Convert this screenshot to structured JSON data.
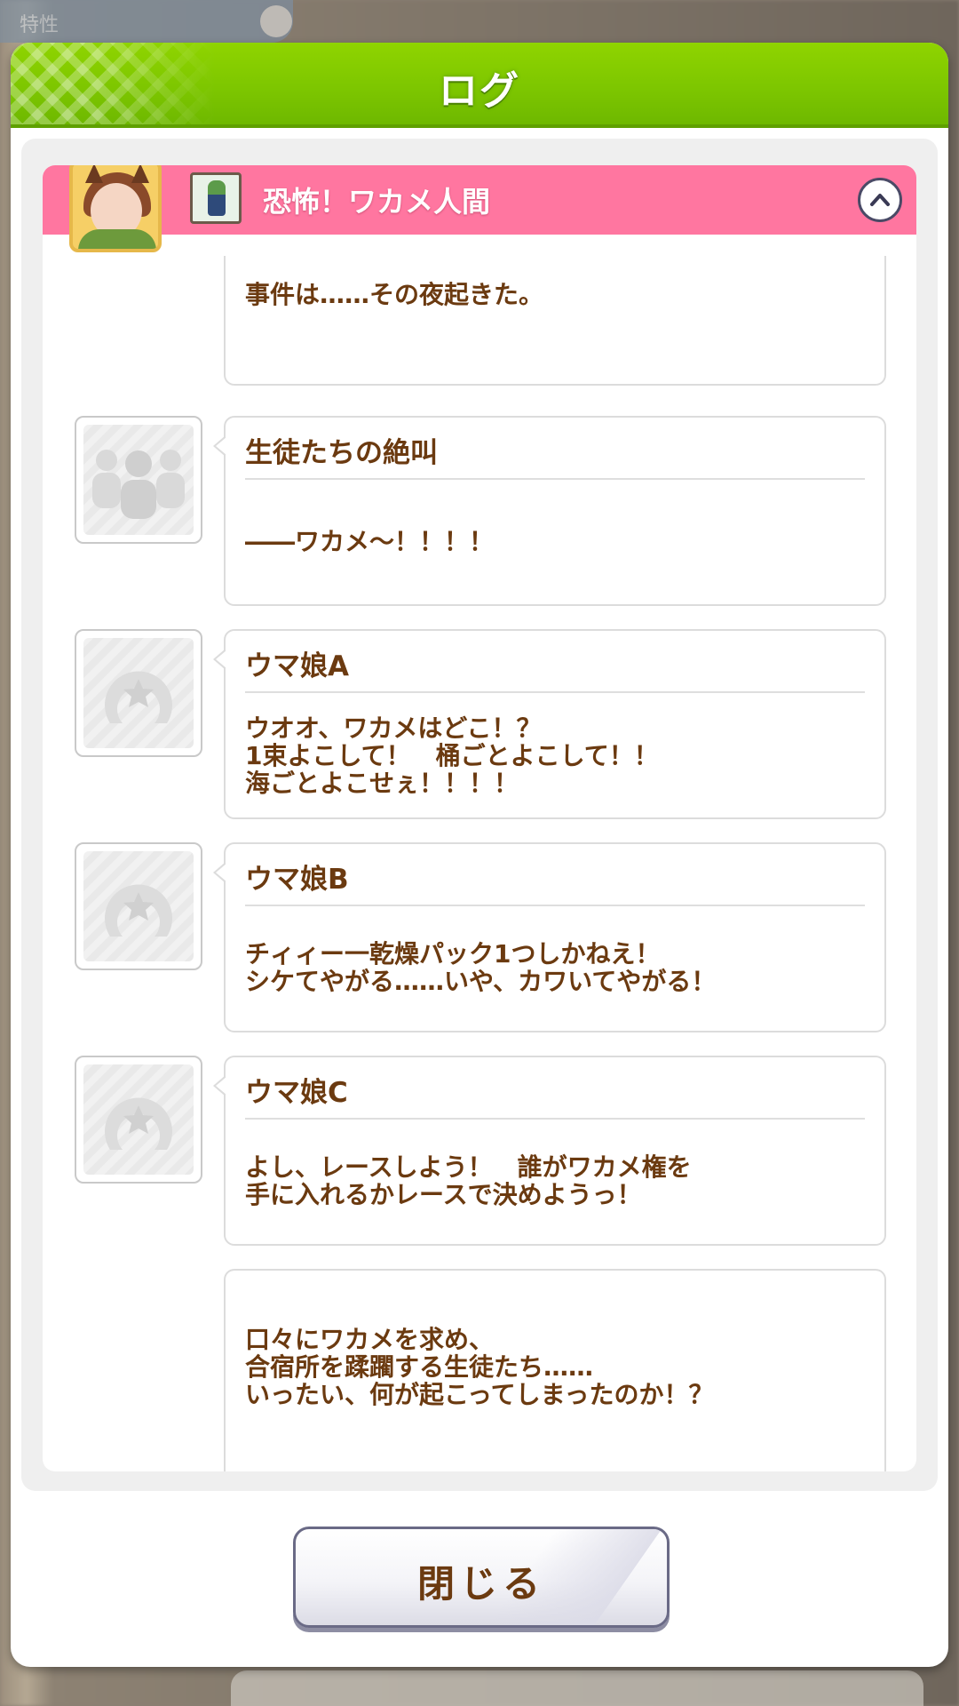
{
  "background": {
    "top_left_text": "特性"
  },
  "modal": {
    "title": "ログ",
    "header_color": "#7cc500",
    "episode": {
      "title": "恐怖！ワカメ人間",
      "bar_color": "#ff76a0",
      "collapse_icon": "chevron-up-icon"
    },
    "entries": [
      {
        "speaker": "",
        "avatar": "none",
        "text": "事件は……その夜起きた。"
      },
      {
        "speaker": "生徒たちの絶叫",
        "avatar": "group-silhouette-icon",
        "text": "――ワカメ～！！！！"
      },
      {
        "speaker": "ウマ娘A",
        "avatar": "horseshoe-star-icon",
        "text": "ウオオ、ワカメはどこ！？\n1束よこして！　桶ごとよこして！！\n海ごとよこせぇ！！！！"
      },
      {
        "speaker": "ウマ娘B",
        "avatar": "horseshoe-star-icon",
        "text": "チィィー一乾燥パック1つしかねえ！\nシケてやがる……いや、カワいてやがる！"
      },
      {
        "speaker": "ウマ娘C",
        "avatar": "horseshoe-star-icon",
        "text": "よし、レースしよう！　誰がワカメ権を\n手に入れるかレースで決めようっ！"
      },
      {
        "speaker": "",
        "avatar": "none",
        "text": "口々にワカメを求め、\n合宿所を蹂躙する生徒たち……\nいったい、何が起こってしまったのか！？"
      }
    ],
    "close_button": {
      "label": "閉じる"
    }
  }
}
